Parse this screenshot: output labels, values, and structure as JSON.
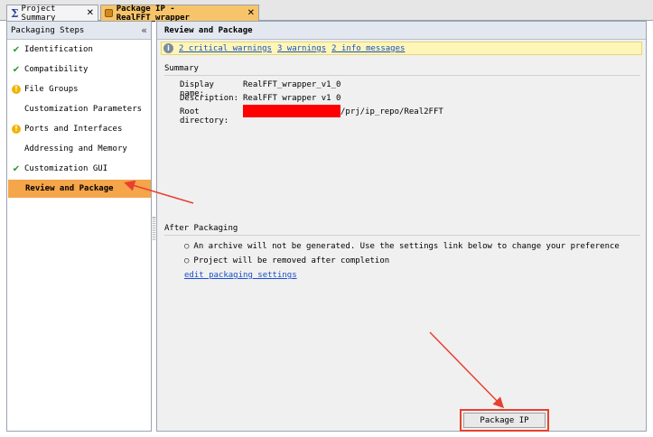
{
  "tabs": [
    {
      "label": "Project Summary",
      "icon": "sigma-icon"
    },
    {
      "label": "Package IP - RealFFT_wrapper",
      "icon": "package-icon"
    }
  ],
  "left": {
    "title": "Packaging Steps",
    "collapse_glyph": "«",
    "steps": [
      {
        "label": "Identification",
        "status": "ok"
      },
      {
        "label": "Compatibility",
        "status": "ok"
      },
      {
        "label": "File Groups",
        "status": "warning"
      },
      {
        "label": "Customization Parameters",
        "status": "none"
      },
      {
        "label": "Ports and Interfaces",
        "status": "warning"
      },
      {
        "label": "Addressing and Memory",
        "status": "none"
      },
      {
        "label": "Customization GUI",
        "status": "ok"
      },
      {
        "label": "Review and Package",
        "status": "active"
      }
    ]
  },
  "right": {
    "title": "Review and Package",
    "messages": {
      "critical": "2 critical warnings",
      "warnings": "3 warnings",
      "info": "2 info messages"
    },
    "summary": {
      "title": "Summary",
      "display_name_label": "Display name:",
      "display_name": "RealFFT_wrapper_v1_0",
      "description_label": "Description:",
      "description": "RealFFT wrapper v1 0",
      "root_label": "Root directory:",
      "root_suffix": "/prj/ip_repo/Real2FFT"
    },
    "after": {
      "title": "After Packaging",
      "bullets": [
        "An archive will not be generated. Use the settings link below to change your preference",
        "Project will be removed after completion"
      ],
      "link": "edit packaging settings"
    },
    "package_button": "Package IP"
  },
  "colors": {
    "active_step": "#f5a54a",
    "active_tab": "#f7c469",
    "annotation": "#e84030",
    "redaction": "#ff0000"
  }
}
